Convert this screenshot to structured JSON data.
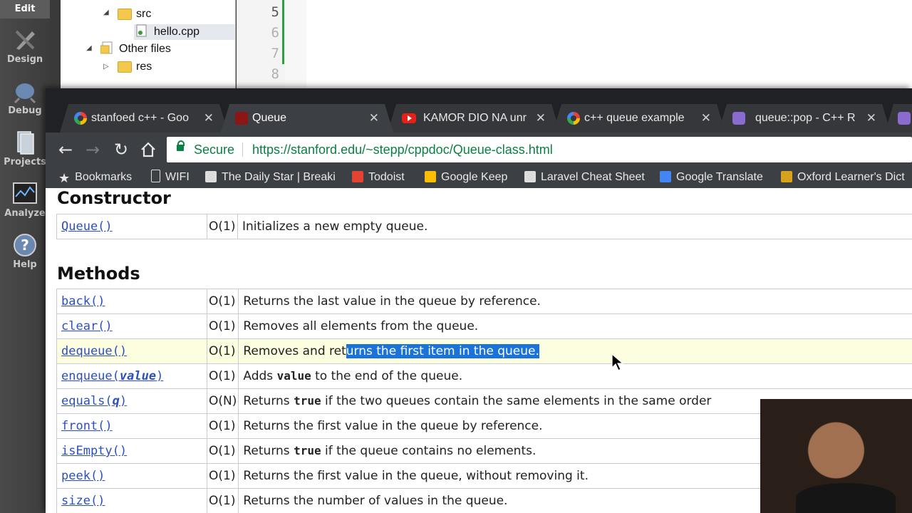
{
  "qt": {
    "modes": [
      {
        "label": "Edit",
        "icon": "edit-icon"
      },
      {
        "label": "Design",
        "icon": "design-icon"
      },
      {
        "label": "Debug",
        "icon": "debug-icon"
      },
      {
        "label": "Projects",
        "icon": "projects-icon"
      },
      {
        "label": "Analyze",
        "icon": "analyze-icon"
      },
      {
        "label": "Help",
        "icon": "help-icon"
      }
    ],
    "tree": [
      {
        "label": "src",
        "icon": "folder-icon"
      },
      {
        "label": "hello.cpp",
        "icon": "cpp-file-icon"
      },
      {
        "label": "Other files",
        "icon": "folder-icon"
      },
      {
        "label": "res",
        "icon": "folder-icon"
      }
    ],
    "line_numbers": [
      "5",
      "6",
      "7",
      "8"
    ]
  },
  "browser": {
    "tabs": [
      {
        "title": "stanfoed c++ - Goo",
        "favicon": "google-icon"
      },
      {
        "title": "Queue",
        "favicon": "stanford-icon"
      },
      {
        "title": "KAMOR DIO NA unr",
        "favicon": "youtube-icon"
      },
      {
        "title": "c++ queue example",
        "favicon": "google-icon"
      },
      {
        "title": "queue::pop - C++ R",
        "favicon": "cplusplus-icon"
      }
    ],
    "close_glyph": "✕",
    "secure_label": "Secure",
    "url": "https://stanford.edu/~stepp/cppdoc/Queue-class.html",
    "bookmarks": [
      {
        "label": "Bookmarks",
        "icon": "star-icon"
      },
      {
        "label": "WIFI",
        "icon": "page-icon"
      },
      {
        "label": "The Daily Star | Breaki",
        "icon": "daily-star-icon"
      },
      {
        "label": "Todoist",
        "icon": "todoist-icon"
      },
      {
        "label": "Google Keep",
        "icon": "keep-icon"
      },
      {
        "label": "Laravel Cheat Sheet",
        "icon": "laravel-icon"
      },
      {
        "label": "Google Translate",
        "icon": "translate-icon"
      },
      {
        "label": "Oxford Learner's Dict",
        "icon": "oxford-icon"
      }
    ]
  },
  "page": {
    "constructor_heading": "Constructor",
    "constructor": {
      "name": "Queue()",
      "complexity": "O(1)",
      "desc": "Initializes a new empty queue."
    },
    "methods_heading": "Methods",
    "methods": [
      {
        "name": "back()",
        "complexity": "O(1)",
        "desc": "Returns the last value in the queue by reference."
      },
      {
        "name": "clear()",
        "complexity": "O(1)",
        "desc": "Removes all elements from the queue."
      },
      {
        "name": "dequeue()",
        "complexity": "O(1)",
        "desc_plain": "Removes and ret",
        "desc_selected": "urns the first item in the queue."
      },
      {
        "name_pre": "enqueue(",
        "name_arg": "value",
        "name_post": ")",
        "complexity": "O(1)",
        "desc_pre": "Adds ",
        "desc_code": "value",
        "desc_post": " to the end of the queue."
      },
      {
        "name_pre": "equals(",
        "name_arg": "q",
        "name_post": ")",
        "complexity": "O(N)",
        "desc_pre": "Returns ",
        "desc_code": "true",
        "desc_post": " if the two queues contain the same elements in the same order"
      },
      {
        "name": "front()",
        "complexity": "O(1)",
        "desc": "Returns the first value in the queue by reference."
      },
      {
        "name": "isEmpty()",
        "complexity": "O(1)",
        "desc_pre": "Returns ",
        "desc_code": "true",
        "desc_post": " if the queue contains no elements."
      },
      {
        "name": "peek()",
        "complexity": "O(1)",
        "desc": "Returns the first value in the queue, without removing it."
      },
      {
        "name": "size()",
        "complexity": "O(1)",
        "desc": "Returns the number of values in the queue."
      }
    ]
  }
}
